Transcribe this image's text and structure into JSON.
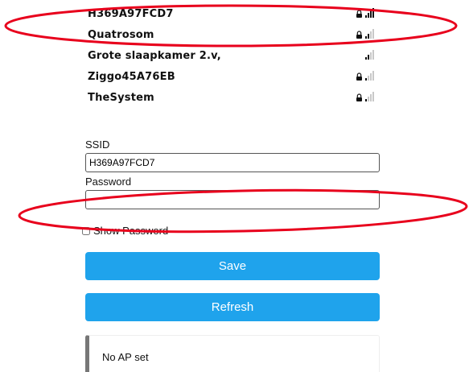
{
  "networks": [
    {
      "name": "H369A97FCD7",
      "locked": true,
      "signal_bars": 4
    },
    {
      "name": "Quatrosom",
      "locked": true,
      "signal_bars": 2
    },
    {
      "name": "Grote slaapkamer 2.v,",
      "locked": false,
      "signal_bars": 2
    },
    {
      "name": "Ziggo45A76EB",
      "locked": true,
      "signal_bars": 1
    },
    {
      "name": "TheSystem",
      "locked": true,
      "signal_bars": 1
    }
  ],
  "form": {
    "ssid_label": "SSID",
    "ssid_value": "H369A97FCD7",
    "password_label": "Password",
    "password_value": "",
    "show_password_label": "Show Password",
    "show_password_checked": false
  },
  "buttons": {
    "save_label": "Save",
    "refresh_label": "Refresh"
  },
  "status": {
    "message": "No AP set"
  },
  "colors": {
    "button": "#1fa3ec",
    "annotation": "#e8001c",
    "status_border": "#777777"
  }
}
